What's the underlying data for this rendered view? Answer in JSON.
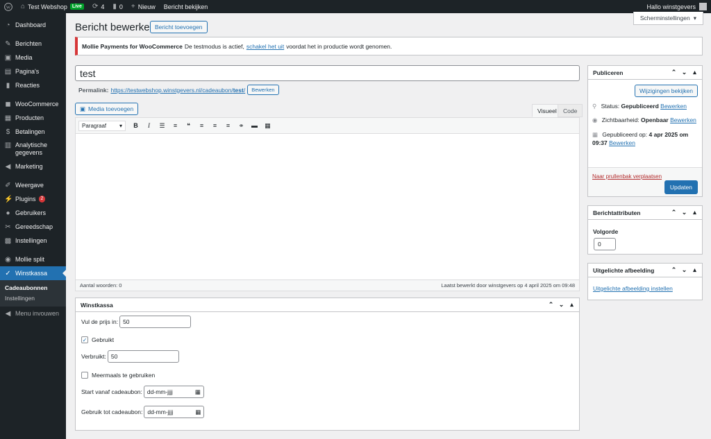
{
  "adminbar": {
    "site_name": "Test Webshop",
    "live_badge": "Live",
    "updates_count": "4",
    "comments_count": "0",
    "new_label": "Nieuw",
    "view_post": "Bericht bekijken",
    "greeting": "Hallo winstgevers",
    "icons": [
      "wordpress-logo-icon",
      "home-icon",
      "refresh-icon",
      "comment-icon",
      "plus-icon"
    ]
  },
  "sidebar": {
    "items": [
      {
        "label": "Dashboard",
        "icon": "dashboard-icon"
      },
      {
        "label": "Berichten",
        "icon": "pin-icon"
      },
      {
        "label": "Media",
        "icon": "media-icon"
      },
      {
        "label": "Pagina's",
        "icon": "page-icon"
      },
      {
        "label": "Reacties",
        "icon": "comment-icon"
      },
      {
        "label": "WooCommerce",
        "icon": "woo-icon"
      },
      {
        "label": "Producten",
        "icon": "box-icon"
      },
      {
        "label": "Betalingen",
        "icon": "dollar-icon"
      },
      {
        "label": "Analytische gegevens",
        "icon": "chart-icon"
      },
      {
        "label": "Marketing",
        "icon": "megaphone-icon"
      },
      {
        "label": "Weergave",
        "icon": "brush-icon"
      },
      {
        "label": "Plugins",
        "icon": "plug-icon",
        "badge": "2"
      },
      {
        "label": "Gebruikers",
        "icon": "users-icon"
      },
      {
        "label": "Gereedschap",
        "icon": "wrench-icon"
      },
      {
        "label": "Instellingen",
        "icon": "settings-icon"
      },
      {
        "label": "Mollie split",
        "icon": "mollie-icon"
      },
      {
        "label": "Winstkassa",
        "icon": "winstkassa-icon"
      }
    ],
    "submenu": [
      "Cadeaubonnen",
      "Instellingen"
    ],
    "collapse": "Menu invouwen"
  },
  "screen_options": "Scherminstellingen",
  "page": {
    "title": "Bericht bewerken",
    "add_new": "Bericht toevoegen"
  },
  "notice": {
    "plugin": "Mollie Payments for WooCommerce",
    "text_before": "De testmodus is actief,",
    "link": "schakel het uit",
    "text_after": "voordat het in productie wordt genomen."
  },
  "post": {
    "title": "test",
    "permalink_label": "Permalink:",
    "permalink_base": "https://testwebshop.winstgevers.nl/cadeaubon/",
    "permalink_slug": "test",
    "permalink_slash": "/",
    "edit_label": "Bewerken"
  },
  "editor": {
    "media_button": "Media toevoegen",
    "tab_visual": "Visueel",
    "tab_code": "Code",
    "format": "Paragraaf",
    "word_count": "Aantal woorden: 0",
    "last_edited": "Laatst bewerkt door winstgevers op 4 april 2025 om 09:48"
  },
  "winstkassa": {
    "title": "Winstkassa",
    "price_label": "Vul de prijs in:",
    "price_value": "50",
    "used_label": "Gebruikt",
    "used_checked": true,
    "consumed_label": "Verbruikt:",
    "consumed_value": "50",
    "multi_label": "Meermaals te gebruiken",
    "multi_checked": false,
    "start_label": "Start vanaf cadeaubon:",
    "start_placeholder": "dd-mm-jjjj",
    "end_label": "Gebruik tot cadeaubon:",
    "end_placeholder": "dd-mm-jjjj"
  },
  "publish": {
    "title": "Publiceren",
    "preview": "Wijzigingen bekijken",
    "status_label": "Status:",
    "status_value": "Gepubliceerd",
    "visibility_label": "Zichtbaarheid:",
    "visibility_value": "Openbaar",
    "published_label": "Gepubliceerd op:",
    "published_value": "4 apr 2025 om",
    "published_time": "09:37",
    "edit": "Bewerken",
    "trash": "Naar prullenbak verplaatsen",
    "update": "Updaten"
  },
  "attributes": {
    "title": "Berichtattributen",
    "order_label": "Volgorde",
    "order_value": "0"
  },
  "featured": {
    "title": "Uitgelichte afbeelding",
    "link": "Uitgelichte afbeelding instellen"
  },
  "colors": {
    "admin_dark": "#1d2327",
    "accent": "#2271b1",
    "live_green": "#00a32a",
    "notice_red": "#d63638"
  }
}
